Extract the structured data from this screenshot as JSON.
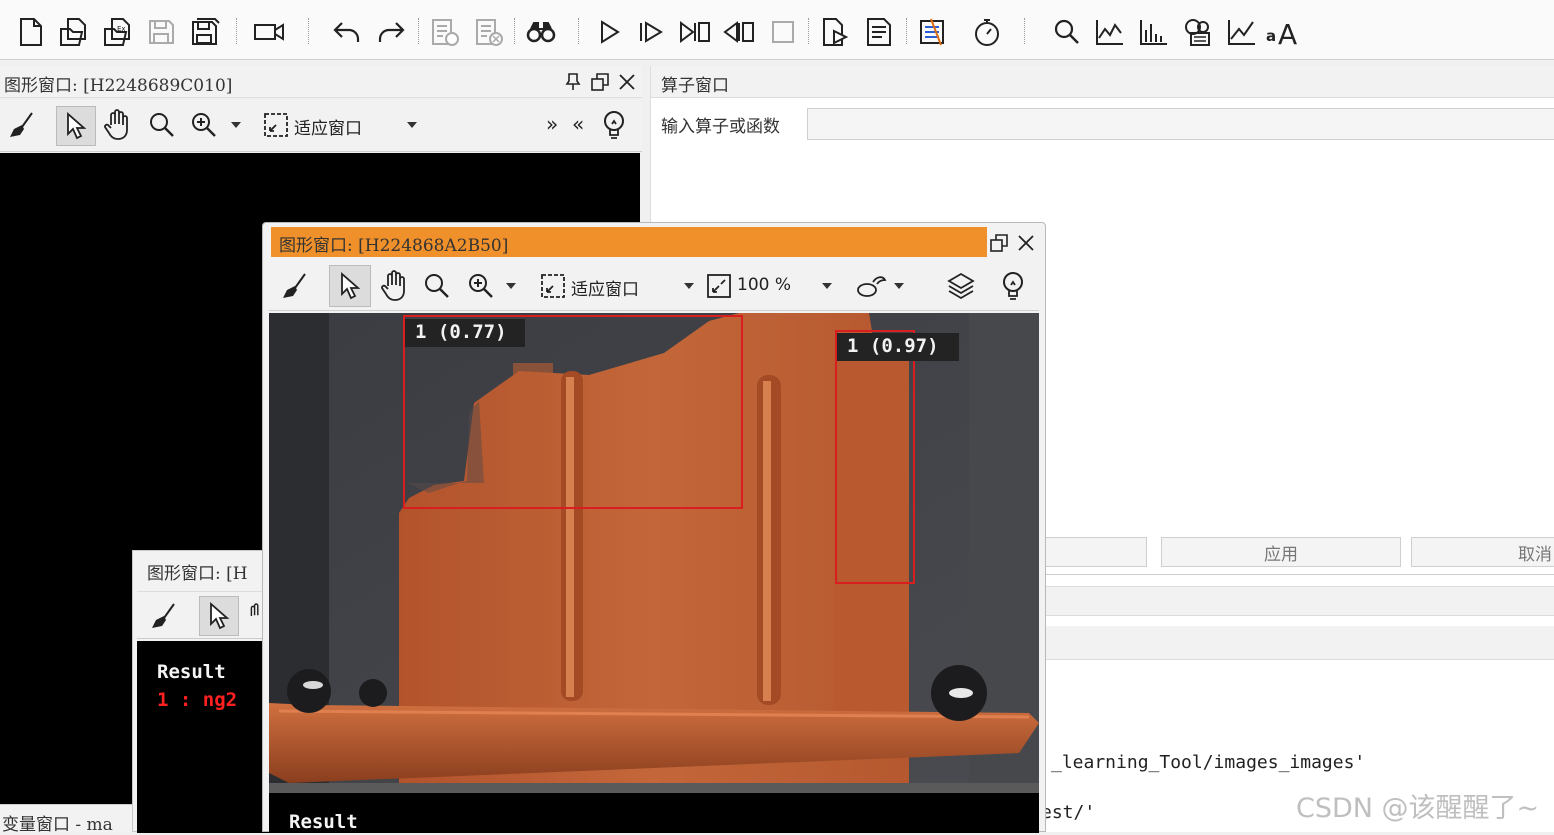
{
  "toolbar": {
    "icons": [
      "new-file-icon",
      "open-file-icon",
      "open-example-icon",
      "save-icon",
      "save-all-icon",
      "record-icon",
      "undo-icon",
      "redo-icon",
      "list-check-icon",
      "list-stop-icon",
      "binoculars-icon",
      "run-icon",
      "step-icon",
      "step-over-icon",
      "step-back-icon",
      "stop-icon",
      "insert-doc-icon",
      "document-icon",
      "breakpoint-icon",
      "timer-icon",
      "zoom-icon",
      "line-profile-icon",
      "histogram-icon",
      "gray-tool-icon",
      "plot-icon",
      "font-icon"
    ]
  },
  "left_window": {
    "title": "图形窗口: [H2248689C010]",
    "zoom_mode": "适应窗口",
    "more": "»",
    "less": "«"
  },
  "operator_window": {
    "title": "算子窗口",
    "input_label": "输入算子或函数",
    "apply": "应用",
    "cancel": "取消"
  },
  "console": {
    "line1": "_learning_Tool/images_images'",
    "line2": "est/'"
  },
  "main_window": {
    "title": "图形窗口: [H224868A2B50]",
    "zoom_mode": "适应窗口",
    "zoom_percent": "100 %",
    "detections": [
      {
        "label": "1 (0.77)"
      },
      {
        "label": "1 (0.97)"
      }
    ],
    "result_heading": "Result"
  },
  "small_window": {
    "title": "图形窗口: [H",
    "result_heading": "Result",
    "result_line": "1 : ng2"
  },
  "variable_window": {
    "title": "变量窗口 - ma"
  },
  "watermark": "CSDN @该醒醒了~",
  "colors": {
    "active_title": "#f0902a",
    "box": "#d81e1e",
    "result_red": "#ff2020"
  }
}
